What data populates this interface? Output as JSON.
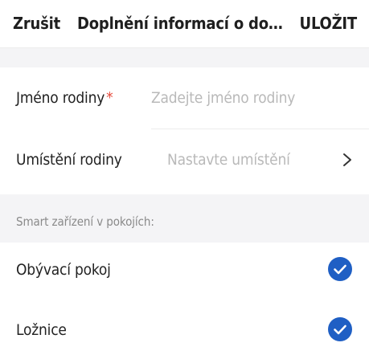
{
  "header": {
    "cancel_label": "Zrušit",
    "title": "Doplnění informací o domácnosti",
    "save_label": "ULOŽIT"
  },
  "form": {
    "family_name": {
      "label": "Jméno rodiny",
      "required_mark": "*",
      "value": "",
      "placeholder": "Zadejte jméno rodiny"
    },
    "family_location": {
      "label": "Umístění rodiny",
      "value_placeholder": "Nastavte umístění",
      "chevron_icon": "chevron-right-icon"
    }
  },
  "rooms_section": {
    "heading": "Smart zařízení v pokojích:",
    "rooms": [
      {
        "label": "Obývací pokoj",
        "checked": true,
        "icon": "check-circle-icon"
      },
      {
        "label": "Ložnice",
        "checked": true,
        "icon": "check-circle-icon"
      }
    ]
  },
  "colors": {
    "accent": "#1f5fc4",
    "required": "#e64a3c",
    "section_background": "#f4f4f6"
  }
}
